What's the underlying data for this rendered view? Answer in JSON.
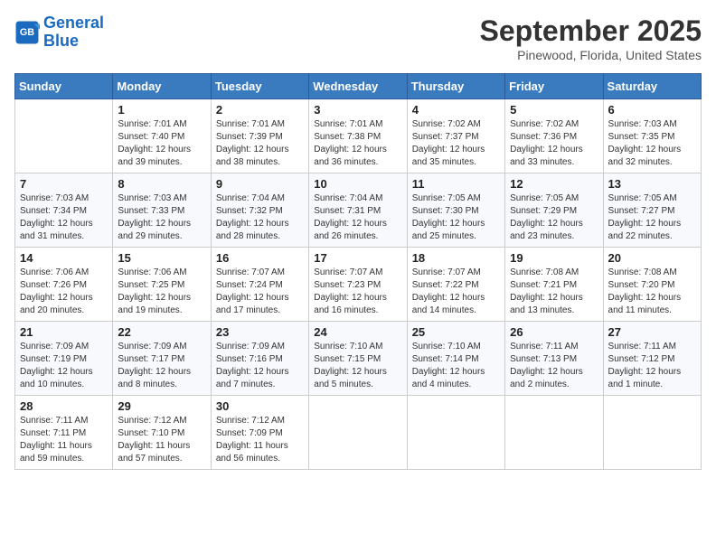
{
  "logo": {
    "line1": "General",
    "line2": "Blue"
  },
  "title": "September 2025",
  "location": "Pinewood, Florida, United States",
  "weekdays": [
    "Sunday",
    "Monday",
    "Tuesday",
    "Wednesday",
    "Thursday",
    "Friday",
    "Saturday"
  ],
  "weeks": [
    [
      {
        "day": "",
        "info": ""
      },
      {
        "day": "1",
        "info": "Sunrise: 7:01 AM\nSunset: 7:40 PM\nDaylight: 12 hours\nand 39 minutes."
      },
      {
        "day": "2",
        "info": "Sunrise: 7:01 AM\nSunset: 7:39 PM\nDaylight: 12 hours\nand 38 minutes."
      },
      {
        "day": "3",
        "info": "Sunrise: 7:01 AM\nSunset: 7:38 PM\nDaylight: 12 hours\nand 36 minutes."
      },
      {
        "day": "4",
        "info": "Sunrise: 7:02 AM\nSunset: 7:37 PM\nDaylight: 12 hours\nand 35 minutes."
      },
      {
        "day": "5",
        "info": "Sunrise: 7:02 AM\nSunset: 7:36 PM\nDaylight: 12 hours\nand 33 minutes."
      },
      {
        "day": "6",
        "info": "Sunrise: 7:03 AM\nSunset: 7:35 PM\nDaylight: 12 hours\nand 32 minutes."
      }
    ],
    [
      {
        "day": "7",
        "info": "Sunrise: 7:03 AM\nSunset: 7:34 PM\nDaylight: 12 hours\nand 31 minutes."
      },
      {
        "day": "8",
        "info": "Sunrise: 7:03 AM\nSunset: 7:33 PM\nDaylight: 12 hours\nand 29 minutes."
      },
      {
        "day": "9",
        "info": "Sunrise: 7:04 AM\nSunset: 7:32 PM\nDaylight: 12 hours\nand 28 minutes."
      },
      {
        "day": "10",
        "info": "Sunrise: 7:04 AM\nSunset: 7:31 PM\nDaylight: 12 hours\nand 26 minutes."
      },
      {
        "day": "11",
        "info": "Sunrise: 7:05 AM\nSunset: 7:30 PM\nDaylight: 12 hours\nand 25 minutes."
      },
      {
        "day": "12",
        "info": "Sunrise: 7:05 AM\nSunset: 7:29 PM\nDaylight: 12 hours\nand 23 minutes."
      },
      {
        "day": "13",
        "info": "Sunrise: 7:05 AM\nSunset: 7:27 PM\nDaylight: 12 hours\nand 22 minutes."
      }
    ],
    [
      {
        "day": "14",
        "info": "Sunrise: 7:06 AM\nSunset: 7:26 PM\nDaylight: 12 hours\nand 20 minutes."
      },
      {
        "day": "15",
        "info": "Sunrise: 7:06 AM\nSunset: 7:25 PM\nDaylight: 12 hours\nand 19 minutes."
      },
      {
        "day": "16",
        "info": "Sunrise: 7:07 AM\nSunset: 7:24 PM\nDaylight: 12 hours\nand 17 minutes."
      },
      {
        "day": "17",
        "info": "Sunrise: 7:07 AM\nSunset: 7:23 PM\nDaylight: 12 hours\nand 16 minutes."
      },
      {
        "day": "18",
        "info": "Sunrise: 7:07 AM\nSunset: 7:22 PM\nDaylight: 12 hours\nand 14 minutes."
      },
      {
        "day": "19",
        "info": "Sunrise: 7:08 AM\nSunset: 7:21 PM\nDaylight: 12 hours\nand 13 minutes."
      },
      {
        "day": "20",
        "info": "Sunrise: 7:08 AM\nSunset: 7:20 PM\nDaylight: 12 hours\nand 11 minutes."
      }
    ],
    [
      {
        "day": "21",
        "info": "Sunrise: 7:09 AM\nSunset: 7:19 PM\nDaylight: 12 hours\nand 10 minutes."
      },
      {
        "day": "22",
        "info": "Sunrise: 7:09 AM\nSunset: 7:17 PM\nDaylight: 12 hours\nand 8 minutes."
      },
      {
        "day": "23",
        "info": "Sunrise: 7:09 AM\nSunset: 7:16 PM\nDaylight: 12 hours\nand 7 minutes."
      },
      {
        "day": "24",
        "info": "Sunrise: 7:10 AM\nSunset: 7:15 PM\nDaylight: 12 hours\nand 5 minutes."
      },
      {
        "day": "25",
        "info": "Sunrise: 7:10 AM\nSunset: 7:14 PM\nDaylight: 12 hours\nand 4 minutes."
      },
      {
        "day": "26",
        "info": "Sunrise: 7:11 AM\nSunset: 7:13 PM\nDaylight: 12 hours\nand 2 minutes."
      },
      {
        "day": "27",
        "info": "Sunrise: 7:11 AM\nSunset: 7:12 PM\nDaylight: 12 hours\nand 1 minute."
      }
    ],
    [
      {
        "day": "28",
        "info": "Sunrise: 7:11 AM\nSunset: 7:11 PM\nDaylight: 11 hours\nand 59 minutes."
      },
      {
        "day": "29",
        "info": "Sunrise: 7:12 AM\nSunset: 7:10 PM\nDaylight: 11 hours\nand 57 minutes."
      },
      {
        "day": "30",
        "info": "Sunrise: 7:12 AM\nSunset: 7:09 PM\nDaylight: 11 hours\nand 56 minutes."
      },
      {
        "day": "",
        "info": ""
      },
      {
        "day": "",
        "info": ""
      },
      {
        "day": "",
        "info": ""
      },
      {
        "day": "",
        "info": ""
      }
    ]
  ]
}
